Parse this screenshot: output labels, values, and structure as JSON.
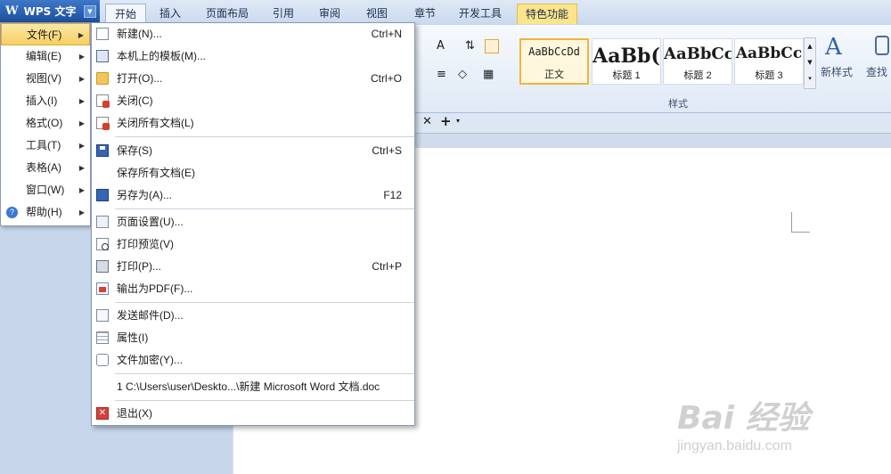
{
  "app": {
    "title": "WPS 文字",
    "logo_letter": "W"
  },
  "tabs": [
    {
      "label": "开始"
    },
    {
      "label": "插入"
    },
    {
      "label": "页面布局"
    },
    {
      "label": "引用"
    },
    {
      "label": "审阅"
    },
    {
      "label": "视图"
    },
    {
      "label": "章节"
    },
    {
      "label": "开发工具"
    },
    {
      "label": "特色功能"
    }
  ],
  "ribbon": {
    "style_group_label": "样式",
    "styles": [
      {
        "sample": "AaBbCcDd",
        "name": "正文"
      },
      {
        "sample": "AaBb(",
        "name": "标题 1"
      },
      {
        "sample": "AaBbCc",
        "name": "标题 2"
      },
      {
        "sample": "AaBbCc",
        "name": "标题 3"
      }
    ],
    "new_style_label": "新样式",
    "find_label": "查找"
  },
  "left_menu": [
    {
      "label": "文件(F)"
    },
    {
      "label": "编辑(E)"
    },
    {
      "label": "视图(V)"
    },
    {
      "label": "插入(I)"
    },
    {
      "label": "格式(O)"
    },
    {
      "label": "工具(T)"
    },
    {
      "label": "表格(A)"
    },
    {
      "label": "窗口(W)"
    },
    {
      "label": "帮助(H)"
    }
  ],
  "file_menu": {
    "new": {
      "label": "新建(N)...",
      "shortcut": "Ctrl+N"
    },
    "template": {
      "label": "本机上的模板(M)..."
    },
    "open": {
      "label": "打开(O)...",
      "shortcut": "Ctrl+O"
    },
    "close": {
      "label": "关闭(C)"
    },
    "close_all": {
      "label": "关闭所有文档(L)"
    },
    "save": {
      "label": "保存(S)",
      "shortcut": "Ctrl+S"
    },
    "save_all": {
      "label": "保存所有文档(E)"
    },
    "save_as": {
      "label": "另存为(A)...",
      "shortcut": "F12"
    },
    "page_setup": {
      "label": "页面设置(U)..."
    },
    "print_preview": {
      "label": "打印预览(V)"
    },
    "print": {
      "label": "打印(P)...",
      "shortcut": "Ctrl+P"
    },
    "export_pdf": {
      "label": "输出为PDF(F)..."
    },
    "send_mail": {
      "label": "发送邮件(D)..."
    },
    "properties": {
      "label": "属性(I)"
    },
    "encrypt": {
      "label": "文件加密(Y)..."
    },
    "recent": {
      "label": "1 C:\\Users\\user\\Deskto...\\新建 Microsoft Word 文档.doc"
    },
    "exit": {
      "label": "退出(X)"
    }
  },
  "watermark": {
    "logo": "Bai 经验",
    "url": "jingyan.baidu.com"
  }
}
